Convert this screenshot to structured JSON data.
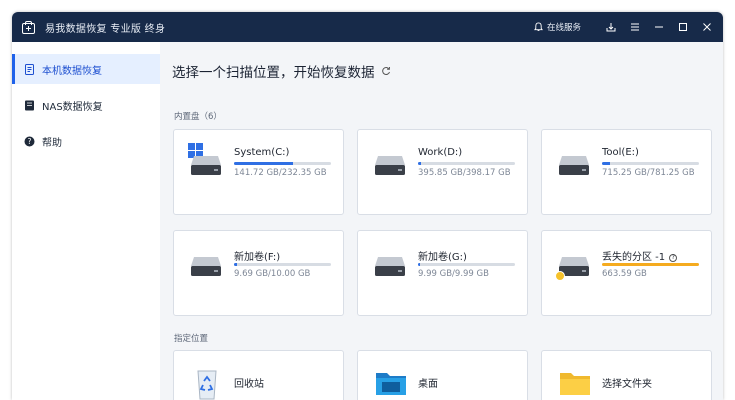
{
  "app": {
    "title": "易我数据恢复 专业版 终身",
    "online_service": "在线服务"
  },
  "sidebar": {
    "items": [
      {
        "label": "本机数据恢复",
        "active": true
      },
      {
        "label": "NAS数据恢复",
        "active": false
      },
      {
        "label": "帮助",
        "active": false
      }
    ]
  },
  "main": {
    "title": "选择一个扫描位置，开始恢复数据",
    "internal_label": "内置盘（6）",
    "drives": [
      {
        "name": "System(C:)",
        "size": "141.72 GB/232.35 GB",
        "used_fraction": 0.61,
        "bar": "blue",
        "windows": true
      },
      {
        "name": "Work(D:)",
        "size": "395.85 GB/398.17 GB",
        "used_fraction": 0.03,
        "bar": "blue"
      },
      {
        "name": "Tool(E:)",
        "size": "715.25 GB/781.25 GB",
        "used_fraction": 0.08,
        "bar": "blue"
      },
      {
        "name": "新加卷(F:)",
        "size": "9.69 GB/10.00 GB",
        "used_fraction": 0.03,
        "bar": "blue"
      },
      {
        "name": "新加卷(G:)",
        "size": "9.99 GB/9.99 GB",
        "used_fraction": 0.02,
        "bar": "blue"
      },
      {
        "name": "丢失的分区 -1",
        "size": "663.59 GB",
        "used_fraction": 1.0,
        "bar": "orange",
        "help": "?"
      }
    ],
    "location_label": "指定位置",
    "locations": [
      {
        "name": "回收站",
        "icon": "recycle-bin-icon"
      },
      {
        "name": "桌面",
        "icon": "desktop-folder-icon"
      },
      {
        "name": "选择文件夹",
        "icon": "folder-icon"
      }
    ]
  },
  "colors": {
    "titlebar": "#172a49",
    "accent": "#2062ea",
    "lost_partition": "#f5ab1f"
  }
}
